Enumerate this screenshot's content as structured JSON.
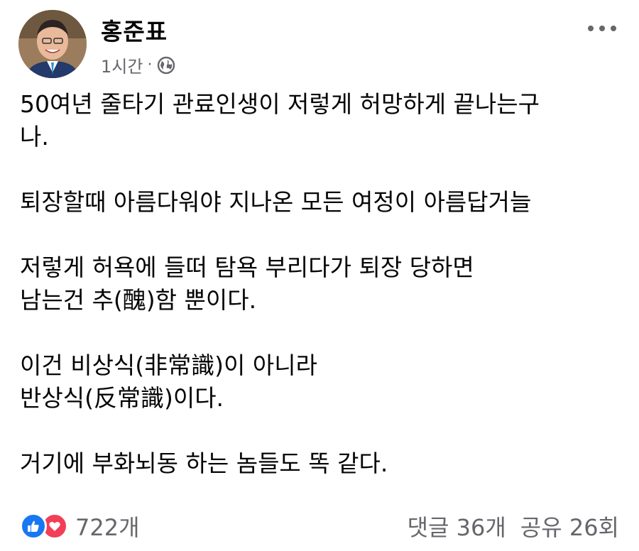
{
  "post": {
    "author": "홍준표",
    "time": "1시간",
    "separator": "·",
    "privacy_icon": "globe-icon",
    "more_icon": "more-options-icon",
    "body": {
      "p1_line1": "50여년 줄타기 관료인생이 저렇게 허망하게 끝나는구",
      "p1_line2": "나.",
      "p2_line1": "퇴장할때 아름다워야 지나온 모든 여정이 아름답거늘",
      "p3_line1": "저렇게 허욕에 들떠 탐욕 부리다가 퇴장 당하면",
      "p3_line2": "남는건 추(醜)함 뿐이다.",
      "p4_line1": "이건 비상식(非常識)이 아니라",
      "p4_line2": "반상식(反常識)이다.",
      "p5_line1": "거기에 부화뇌동 하는 놈들도 똑 같다."
    },
    "footer": {
      "reaction_icons": [
        "like-icon",
        "love-icon"
      ],
      "reaction_count": "722개",
      "comments": "댓글 36개",
      "shares": "공유 26회"
    },
    "colors": {
      "text": "#050505",
      "secondary": "#65676b",
      "like": "#1877f2",
      "love": "#f33e58"
    }
  }
}
